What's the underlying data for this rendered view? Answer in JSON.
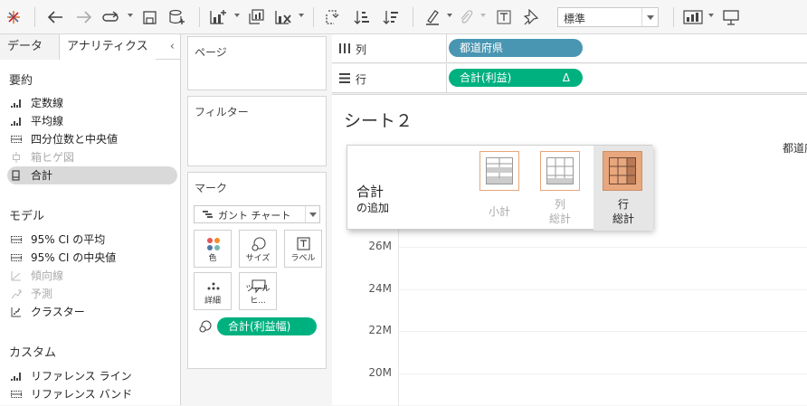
{
  "toolbar": {
    "fit_value": "標準",
    "icons": [
      "tableau-logo-icon",
      "undo-icon",
      "redo-icon",
      "replay-icon",
      "save-icon",
      "new-datasource-icon",
      "new-worksheet-icon",
      "duplicate-icon",
      "clear-sheet-icon",
      "swap-icon",
      "sort-asc-icon",
      "sort-desc-icon",
      "highlight-icon",
      "attach-icon",
      "text-label-icon",
      "pin-icon",
      "show-me-icon",
      "presentation-icon"
    ]
  },
  "left_pane": {
    "tab_data": "データ",
    "tab_analytics": "アナリティクス",
    "collapse": "‹",
    "summary_title": "要約",
    "summary_items": [
      {
        "label": "定数線",
        "enabled": true
      },
      {
        "label": "平均線",
        "enabled": true
      },
      {
        "label": "四分位数と中央値",
        "enabled": true
      },
      {
        "label": "箱ヒゲ図",
        "enabled": false
      },
      {
        "label": "合計",
        "enabled": true,
        "selected": true
      }
    ],
    "model_title": "モデル",
    "model_items": [
      {
        "label": "95% CI の平均",
        "enabled": true
      },
      {
        "label": "95% CI の中央値",
        "enabled": true
      },
      {
        "label": "傾向線",
        "enabled": false
      },
      {
        "label": "予測",
        "enabled": false
      },
      {
        "label": "クラスター",
        "enabled": true
      }
    ],
    "custom_title": "カスタム",
    "custom_items": [
      {
        "label": "リファレンス ライン",
        "enabled": true
      },
      {
        "label": "リファレンス バンド",
        "enabled": true
      }
    ]
  },
  "cards": {
    "pages": "ページ",
    "filters": "フィルター",
    "marks": "マーク",
    "mark_type": "ガント チャート",
    "mark_buttons": [
      "色",
      "サイズ",
      "ラベル",
      "詳細",
      "ツールヒ..."
    ],
    "size_pill": "合計(利益幅)"
  },
  "shelves": {
    "columns_label": "列",
    "rows_label": "行",
    "columns_pill": "都道府県",
    "rows_pill": "合計(利益)",
    "rows_pill_delta": "Δ"
  },
  "view": {
    "sheet_title": "シート２",
    "column_header": "都道府",
    "y_ticks": [
      "26M",
      "24M",
      "22M",
      "20M"
    ]
  },
  "totals_popup": {
    "title": "合計",
    "subtitle": "の追加",
    "options": [
      {
        "line1": "小計",
        "line2": "",
        "active": false
      },
      {
        "line1": "列",
        "line2": "総計",
        "active": false
      },
      {
        "line1": "行",
        "line2": "総計",
        "active": true
      }
    ]
  },
  "colors": {
    "blue_pill": "#4996b2",
    "green_pill": "#00b180",
    "popup_accent": "#e8a77d"
  }
}
